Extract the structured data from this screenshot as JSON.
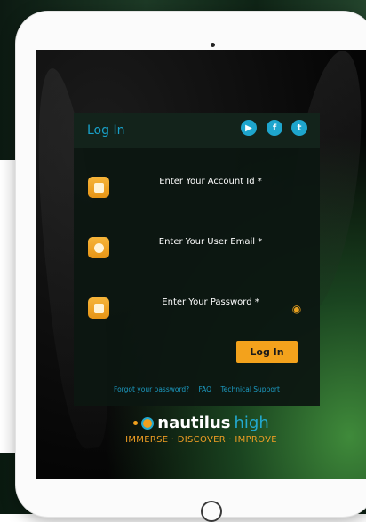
{
  "login": {
    "title": "Log In",
    "fields": [
      {
        "label": "Enter Your Account Id *",
        "icon": "id-card-icon"
      },
      {
        "label": "Enter Your User Email *",
        "icon": "user-icon"
      },
      {
        "label": "Enter Your Password *",
        "icon": "keypad-icon"
      }
    ],
    "password_visibility_icon": "eye-off-icon",
    "submit_label": "Log In",
    "social": [
      {
        "icon": "youtube-icon",
        "glyph": "▶"
      },
      {
        "icon": "facebook-icon",
        "glyph": "f"
      },
      {
        "icon": "twitter-icon",
        "glyph": "t"
      }
    ],
    "links": [
      "Forgot your password?",
      "FAQ",
      "Technical Support"
    ]
  },
  "brand": {
    "name_main": "nautilus",
    "name_accent": "high",
    "tagline": "IMMERSE · DISCOVER · IMPROVE"
  },
  "colors": {
    "accent_blue": "#19a0c8",
    "accent_orange": "#f3a21c",
    "panel": "#0c1611"
  }
}
